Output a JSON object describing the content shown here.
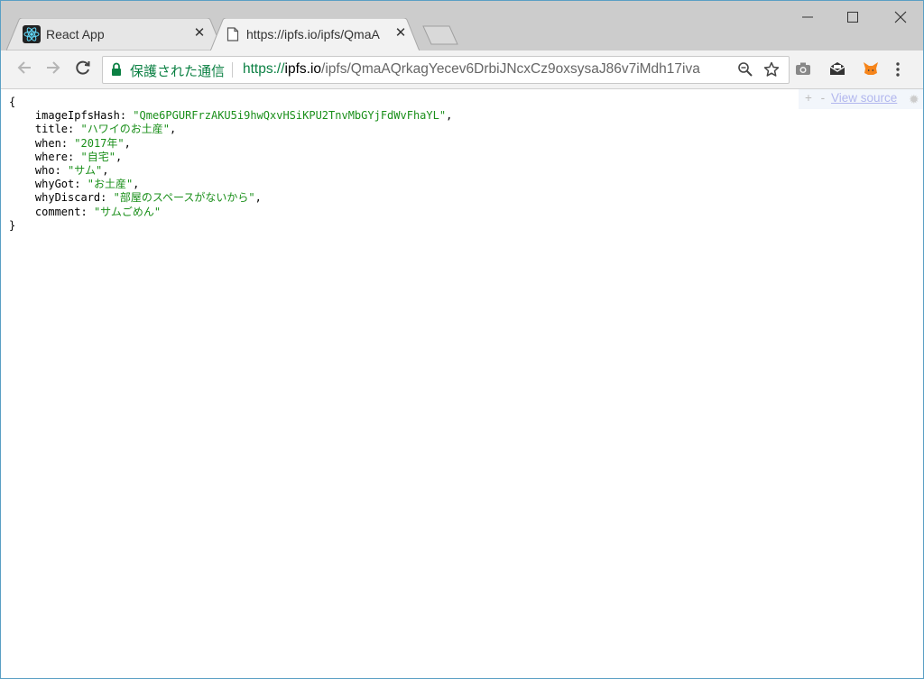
{
  "tabs": [
    {
      "label": "React App",
      "active": false,
      "icon": "react-icon"
    },
    {
      "label": "https://ipfs.io/ipfs/QmaA",
      "active": true,
      "icon": "document-icon"
    }
  ],
  "toolbar": {
    "secure_label": "保護された通信",
    "url_scheme": "https://",
    "url_host": "ipfs.io",
    "url_path": "/ipfs/QmaAQrkagYecev6DrbiJNcxCz9oxsysaJ86v7iMdh17iva"
  },
  "json_view": {
    "open_brace": "{",
    "close_brace": "}",
    "entries": [
      {
        "key": "imageIpfsHash",
        "value": "\"Qme6PGURFrzAKU5i9hwQxvHSiKPU2TnvMbGYjFdWvFhaYL\"",
        "comma": ","
      },
      {
        "key": "title",
        "value": "\"ハワイのお土産\"",
        "comma": ","
      },
      {
        "key": "when",
        "value": "\"2017年\"",
        "comma": ","
      },
      {
        "key": "where",
        "value": "\"自宅\"",
        "comma": ","
      },
      {
        "key": "who",
        "value": "\"サム\"",
        "comma": ","
      },
      {
        "key": "whyGot",
        "value": "\"お土産\"",
        "comma": ","
      },
      {
        "key": "whyDiscard",
        "value": "\"部屋のスペースがないから\"",
        "comma": ","
      },
      {
        "key": "comment",
        "value": "\"サムごめん\"",
        "comma": ""
      }
    ]
  },
  "viewer_controls": {
    "plus": "+",
    "minus": "-",
    "view_source": "View source"
  },
  "colors": {
    "secure_green": "#0b8043",
    "json_string": "#1a8f1a",
    "titlebar": "#cccccc"
  }
}
